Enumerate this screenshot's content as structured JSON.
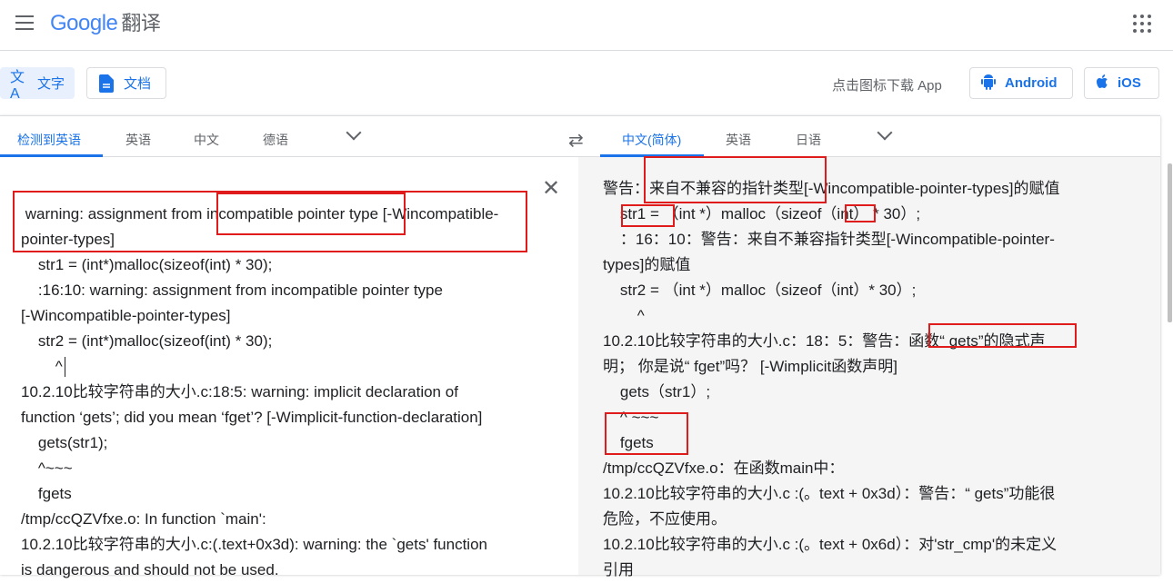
{
  "header": {
    "logo_google": "Google",
    "product": "翻译"
  },
  "modes": {
    "text": "文字",
    "document": "文档"
  },
  "download": {
    "label": "点击图标下载 App",
    "android": "Android",
    "ios": "iOS"
  },
  "source_langs": {
    "detected": "检测到英语",
    "l1": "英语",
    "l2": "中文",
    "l3": "德语"
  },
  "target_langs": {
    "selected": "中文(简体)",
    "l1": "英语",
    "l2": "日语"
  },
  "source_text": [
    " warning: assignment from incompatible pointer type [-Wincompatible-",
    "pointer-types]",
    "    str1 = (int*)malloc(sizeof(int) * 30);",
    "    :16:10: warning: assignment from incompatible pointer type",
    "[-Wincompatible-pointer-types]",
    "    str2 = (int*)malloc(sizeof(int) * 30);",
    "        ^",
    "10.2.10比较字符串的大小.c:18:5: warning: implicit declaration of",
    "function ‘gets’; did you mean ‘fget’? [-Wimplicit-function-declaration]",
    "    gets(str1);",
    "    ^~~~",
    "    fgets",
    "/tmp/ccQZVfxe.o: In function `main':",
    "10.2.10比较字符串的大小.c:(.text+0x3d): warning: the `gets' function",
    "is dangerous and should not be used."
  ],
  "target_text": [
    "警告：来自不兼容的指针类型[-Wincompatible-pointer-types]的赋值",
    "    str1 = （int *）malloc（sizeof（int） * 30）;",
    "    ：16：10：警告：来自不兼容指针类型[-Wincompatible-pointer-",
    "types]的赋值",
    "    str2 = （int *）malloc（sizeof（int）* 30）;",
    "        ^",
    "10.2.10比较字符串的大小.c：18：5：警告：函数“ gets”的隐式声",
    "明； 你是说“ fget”吗？ [-Wimplicit函数声明]",
    "    gets（str1）;",
    "    ^ ~~~",
    "    fgets",
    "/tmp/ccQZVfxe.o：在函数main中：",
    "10.2.10比较字符串的大小.c :(。text + 0x3d）：警告：“ gets”功能很",
    "危险，不应使用。",
    "10.2.10比较字符串的大小.c :(。text + 0x6d）：对'str_cmp'的未定义",
    "引用"
  ]
}
